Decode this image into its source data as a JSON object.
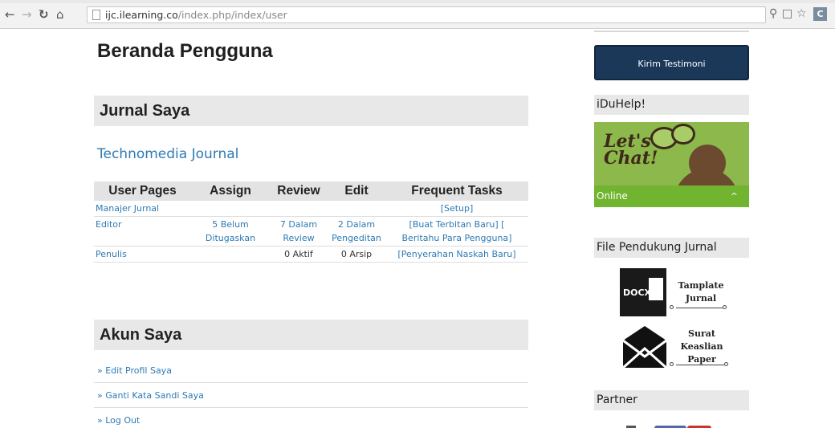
{
  "browser": {
    "url_host": "ijc.ilearning.co",
    "url_path": "/index.php/index/user"
  },
  "main": {
    "page_title": "Beranda Pengguna",
    "section_journals": "Jurnal Saya",
    "journal_name": "Technomedia Journal",
    "table": {
      "headers": [
        "User Pages",
        "Assign",
        "Review",
        "Edit",
        "Frequent Tasks"
      ],
      "rows": [
        {
          "role": "Manajer Jurnal",
          "assign": "",
          "review": "",
          "edit": "",
          "tasks": "[Setup]"
        },
        {
          "role": "Editor",
          "assign": "5 Belum Ditugaskan",
          "review": "7 Dalam Review",
          "edit": "2 Dalam Pengeditan",
          "tasks_1": "[Buat Terbitan Baru] [",
          "tasks_2": "Beritahu Para Pengguna]"
        },
        {
          "role": "Penulis",
          "assign": "",
          "review": "0 Aktif",
          "edit": "0 Arsip",
          "tasks": "[Penyerahan Naskah Baru]"
        }
      ]
    },
    "section_account": "Akun Saya",
    "account_links": [
      "» Edit Profil Saya",
      "» Ganti Kata Sandi Saya",
      "» Log Out"
    ]
  },
  "sidebar": {
    "testimoni_button": "Kirim Testimoni",
    "help_title": "iDuHelp!",
    "chat_line1": "Let's",
    "chat_line2": "Chat!",
    "online_label": "Online",
    "online_caret": "^",
    "files_title": "File Pendukung Jurnal",
    "docx_label": "DOCX",
    "template_line1": "Tamplate",
    "template_line2": "Jurnal",
    "surat_line1": "Surat",
    "surat_line2": "Keaslian",
    "surat_line3": "Paper",
    "partner_title": "Partner"
  }
}
